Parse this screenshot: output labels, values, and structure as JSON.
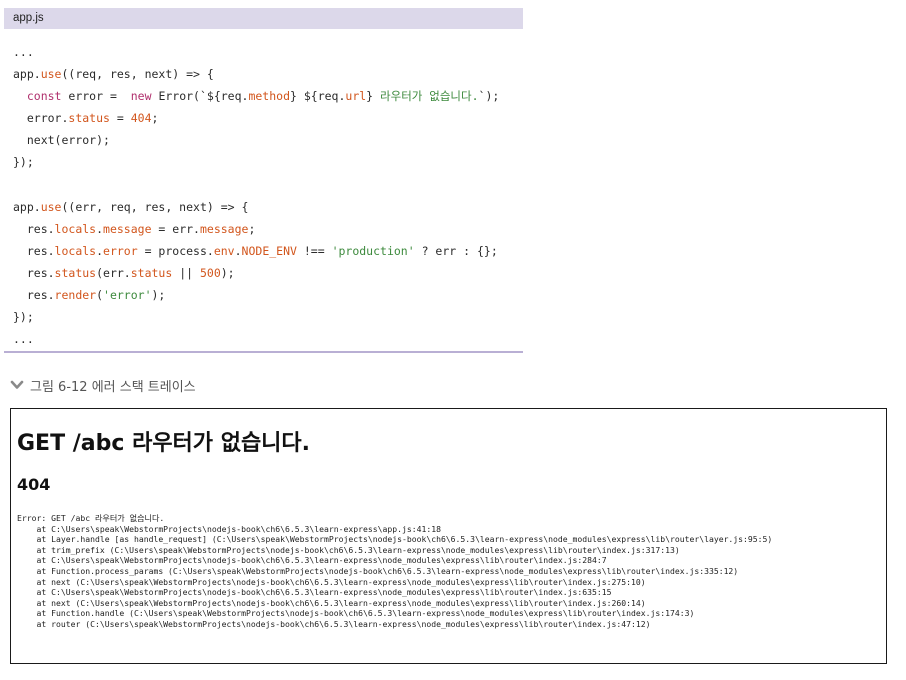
{
  "code": {
    "filename": "app.js",
    "lines": [
      [
        {
          "t": "..."
        }
      ],
      [
        {
          "t": "app."
        },
        {
          "t": "use",
          "c": "prop"
        },
        {
          "t": "((req, res, next) => {"
        }
      ],
      [
        {
          "t": "  "
        },
        {
          "t": "const",
          "c": "kw"
        },
        {
          "t": " error =  "
        },
        {
          "t": "new",
          "c": "kw"
        },
        {
          "t": " Error(`${req."
        },
        {
          "t": "method",
          "c": "prop"
        },
        {
          "t": "} ${req."
        },
        {
          "t": "url",
          "c": "prop"
        },
        {
          "t": "} "
        },
        {
          "t": "라우터가 없습니다.",
          "c": "str"
        },
        {
          "t": "`);"
        }
      ],
      [
        {
          "t": "  error."
        },
        {
          "t": "status",
          "c": "prop"
        },
        {
          "t": " = "
        },
        {
          "t": "404",
          "c": "num"
        },
        {
          "t": ";"
        }
      ],
      [
        {
          "t": "  next(error);"
        }
      ],
      [
        {
          "t": "});"
        }
      ],
      [
        {
          "t": ""
        }
      ],
      [
        {
          "t": "app."
        },
        {
          "t": "use",
          "c": "prop"
        },
        {
          "t": "((err, req, res, next) => {"
        }
      ],
      [
        {
          "t": "  res."
        },
        {
          "t": "locals",
          "c": "prop"
        },
        {
          "t": "."
        },
        {
          "t": "message",
          "c": "prop"
        },
        {
          "t": " = err."
        },
        {
          "t": "message",
          "c": "prop"
        },
        {
          "t": ";"
        }
      ],
      [
        {
          "t": "  res."
        },
        {
          "t": "locals",
          "c": "prop"
        },
        {
          "t": "."
        },
        {
          "t": "error",
          "c": "prop"
        },
        {
          "t": " = process."
        },
        {
          "t": "env",
          "c": "prop"
        },
        {
          "t": "."
        },
        {
          "t": "NODE_ENV",
          "c": "prop"
        },
        {
          "t": " !== "
        },
        {
          "t": "'production'",
          "c": "str"
        },
        {
          "t": " ? err : {};"
        }
      ],
      [
        {
          "t": "  res."
        },
        {
          "t": "status",
          "c": "prop"
        },
        {
          "t": "(err."
        },
        {
          "t": "status",
          "c": "prop"
        },
        {
          "t": " || "
        },
        {
          "t": "500",
          "c": "num"
        },
        {
          "t": ");"
        }
      ],
      [
        {
          "t": "  res."
        },
        {
          "t": "render",
          "c": "prop"
        },
        {
          "t": "("
        },
        {
          "t": "'error'",
          "c": "str"
        },
        {
          "t": ");"
        }
      ],
      [
        {
          "t": "});"
        }
      ],
      [
        {
          "t": "..."
        }
      ]
    ]
  },
  "caption": {
    "icon": "chevron-down-icon",
    "text": "그림 6-12 에러 스택 트레이스"
  },
  "error_page": {
    "title": "GET /abc 라우터가 없습니다.",
    "status": "404",
    "stack": [
      "Error: GET /abc 라우터가 없습니다.",
      "    at C:\\Users\\speak\\WebstormProjects\\nodejs-book\\ch6\\6.5.3\\learn-express\\app.js:41:18",
      "    at Layer.handle [as handle_request] (C:\\Users\\speak\\WebstormProjects\\nodejs-book\\ch6\\6.5.3\\learn-express\\node_modules\\express\\lib\\router\\layer.js:95:5)",
      "    at trim_prefix (C:\\Users\\speak\\WebstormProjects\\nodejs-book\\ch6\\6.5.3\\learn-express\\node_modules\\express\\lib\\router\\index.js:317:13)",
      "    at C:\\Users\\speak\\WebstormProjects\\nodejs-book\\ch6\\6.5.3\\learn-express\\node_modules\\express\\lib\\router\\index.js:284:7",
      "    at Function.process_params (C:\\Users\\speak\\WebstormProjects\\nodejs-book\\ch6\\6.5.3\\learn-express\\node_modules\\express\\lib\\router\\index.js:335:12)",
      "    at next (C:\\Users\\speak\\WebstormProjects\\nodejs-book\\ch6\\6.5.3\\learn-express\\node_modules\\express\\lib\\router\\index.js:275:10)",
      "    at C:\\Users\\speak\\WebstormProjects\\nodejs-book\\ch6\\6.5.3\\learn-express\\node_modules\\express\\lib\\router\\index.js:635:15",
      "    at next (C:\\Users\\speak\\WebstormProjects\\nodejs-book\\ch6\\6.5.3\\learn-express\\node_modules\\express\\lib\\router\\index.js:260:14)",
      "    at Function.handle (C:\\Users\\speak\\WebstormProjects\\nodejs-book\\ch6\\6.5.3\\learn-express\\node_modules\\express\\lib\\router\\index.js:174:3)",
      "    at router (C:\\Users\\speak\\WebstormProjects\\nodejs-book\\ch6\\6.5.3\\learn-express\\node_modules\\express\\lib\\router\\index.js:47:12)"
    ]
  }
}
